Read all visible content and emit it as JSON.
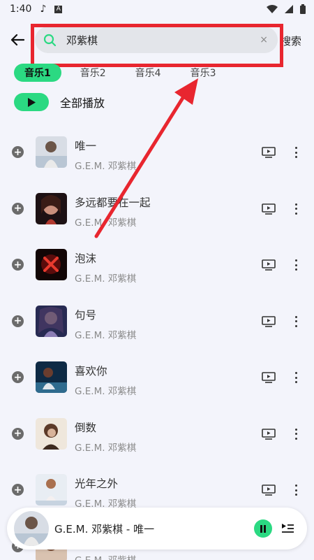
{
  "status_bar": {
    "time": "1:40"
  },
  "search": {
    "value": "邓紫棋",
    "placeholder": "",
    "clear_glyph": "×",
    "submit_label": "搜索"
  },
  "tabs": [
    {
      "label": "音乐1",
      "active": true
    },
    {
      "label": "音乐2",
      "active": false
    },
    {
      "label": "音乐4",
      "active": false
    },
    {
      "label": "音乐3",
      "active": false
    }
  ],
  "play_all": {
    "label": "全部播放"
  },
  "songs": [
    {
      "title": "唯一",
      "artist": "G.E.M. 邓紫棋"
    },
    {
      "title": "多远都要在一起",
      "artist": "G.E.M. 邓紫棋"
    },
    {
      "title": "泡沫",
      "artist": "G.E.M. 邓紫棋"
    },
    {
      "title": "句号",
      "artist": "G.E.M. 邓紫棋"
    },
    {
      "title": "喜欢你",
      "artist": "G.E.M. 邓紫棋"
    },
    {
      "title": "倒数",
      "artist": "G.E.M. 邓紫棋"
    },
    {
      "title": "光年之外",
      "artist": "G.E.M. 邓紫棋"
    },
    {
      "title": "",
      "artist": "G.E.M. 邓紫棋"
    }
  ],
  "player": {
    "now_playing": "G.E.M. 邓紫棋 - 唯一"
  },
  "colors": {
    "accent": "#2bd982",
    "annotation": "#e8262f",
    "background": "#f3f4fb"
  },
  "icons": [
    "back-arrow-icon",
    "search-icon",
    "clear-icon",
    "play-icon",
    "add-circle-icon",
    "mv-icon",
    "more-vertical-icon",
    "pause-icon",
    "queue-icon"
  ]
}
